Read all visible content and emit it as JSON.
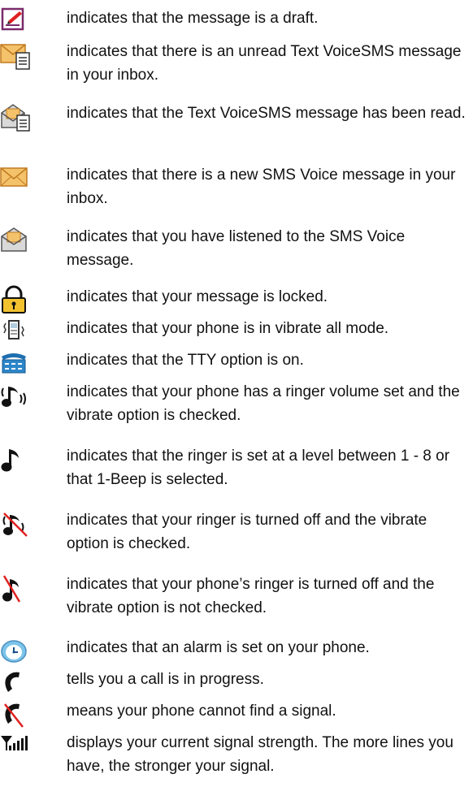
{
  "items": [
    {
      "icon": "draft-icon",
      "text": "indicates that the message is a draft."
    },
    {
      "icon": "unread-text-voicesms-icon",
      "text": "indicates that there is an unread Text VoiceSMS message in your inbox."
    },
    {
      "icon": "read-text-voicesms-icon",
      "text": "indicates that the Text VoiceSMS message has been read."
    },
    {
      "icon": "new-sms-voice-icon",
      "text": "indicates that there is a new SMS Voice message in your inbox."
    },
    {
      "icon": "listened-sms-voice-icon",
      "text": "indicates that you have listened to the SMS Voice message."
    },
    {
      "icon": "lock-icon",
      "text": "indicates that your message is locked."
    },
    {
      "icon": "vibrate-all-icon",
      "text": "indicates that your phone is in vibrate all mode."
    },
    {
      "icon": "tty-icon",
      "text": "indicates that the TTY option is on."
    },
    {
      "icon": "ringer-vibrate-icon",
      "text": "indicates that your phone has a ringer volume set and the vibrate option is checked."
    },
    {
      "icon": "ringer-icon",
      "text": "indicates that the ringer is set at a level between 1 - 8 or that 1-Beep is selected."
    },
    {
      "icon": "ringer-off-vibrate-icon",
      "text": "indicates that your ringer is turned off and the vibrate option is checked."
    },
    {
      "icon": "ringer-off-icon",
      "text": "indicates that your phone’s ringer is turned off and the vibrate option is not checked."
    },
    {
      "icon": "alarm-icon",
      "text": "indicates that an alarm is set on your phone."
    },
    {
      "icon": "call-in-progress-icon",
      "text": "tells you a call is in progress."
    },
    {
      "icon": "no-signal-icon",
      "text": "means your phone cannot find a signal."
    },
    {
      "icon": "signal-strength-icon",
      "text": "displays your current signal strength. The more lines you have, the stronger your signal."
    }
  ]
}
